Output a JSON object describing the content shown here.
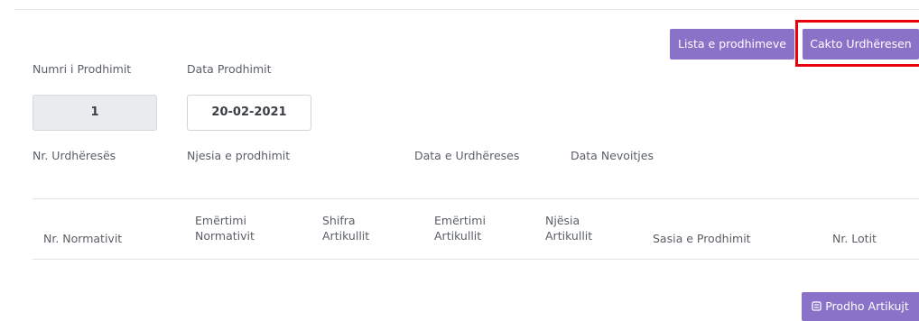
{
  "toolbar": {
    "list_label": "Lista e prodhimeve",
    "assign_label": "Cakto Urdhëresen"
  },
  "form": {
    "production_number_label": "Numri i Prodhimit",
    "production_date_label": "Data Prodhimit",
    "production_number_value": "1",
    "production_date_value": "20-02-2021",
    "order_number_label": "Nr. Urdhëresës",
    "production_unit_label": "Njesia e prodhimit",
    "order_date_label": "Data e Urdhëreses",
    "need_date_label": "Data Nevoitjes"
  },
  "table": {
    "columns": [
      "Nr. Normativit",
      "Emërtimi Normativit",
      "Shifra Artikullit",
      "Emërtimi Artikullit",
      "Njësia Artikullit",
      "Sasia e Prodhimit",
      "Nr. Lotit"
    ],
    "columns_split": {
      "c1a": "Emërtimi",
      "c1b": "Normativit",
      "c2a": "Shifra",
      "c2b": "Artikullit",
      "c3a": "Emërtimi",
      "c3b": "Artikullit",
      "c4a": "Njësia",
      "c4b": "Artikullit"
    }
  },
  "footer": {
    "produce_label": "Prodho Artikujt",
    "produce_icon": "production-icon"
  },
  "colors": {
    "button": "#8a72c9",
    "highlight": "#e8000b"
  }
}
